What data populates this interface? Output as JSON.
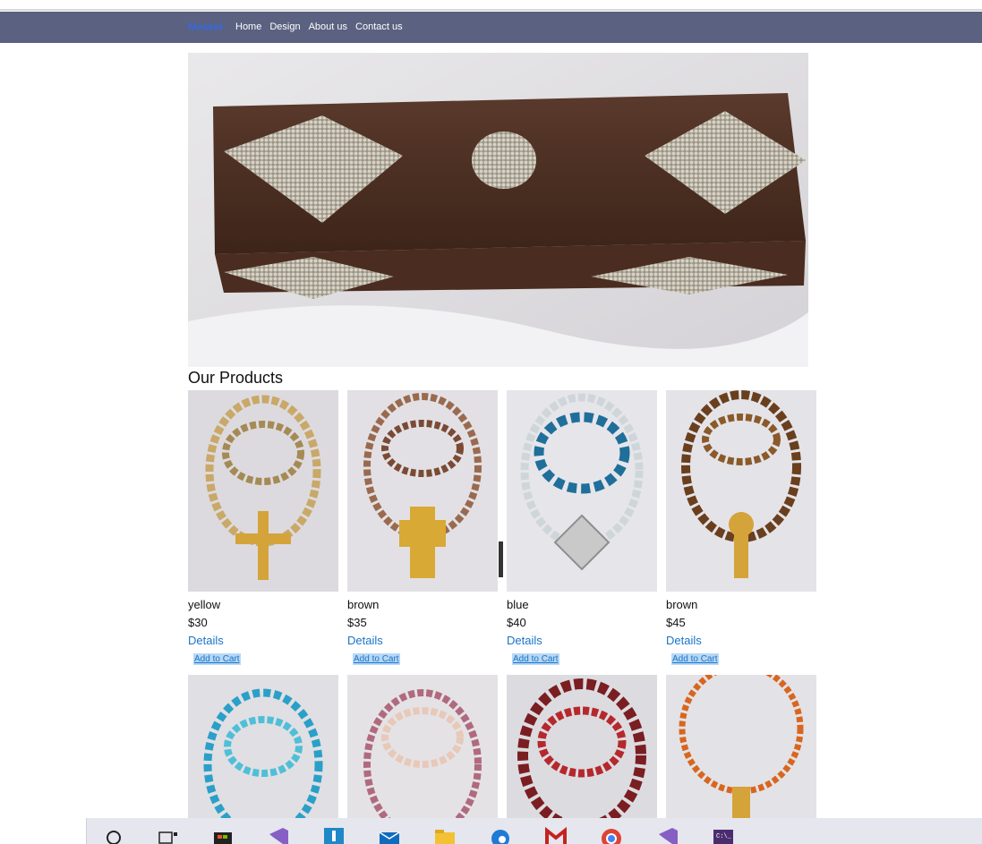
{
  "brand": "Meskel",
  "nav": [
    "Home",
    "Design",
    "About us",
    "Contact us"
  ],
  "section_title": "Our Products",
  "products": [
    {
      "name": "yellow",
      "price": "$30",
      "details": "Details",
      "cart": "Add to Cart"
    },
    {
      "name": "brown",
      "price": "$35",
      "details": "Details",
      "cart": "Add to Cart"
    },
    {
      "name": "blue",
      "price": "$40",
      "details": "Details",
      "cart": "Add to Cart"
    },
    {
      "name": "brown",
      "price": "$45",
      "details": "Details",
      "cart": "Add to Cart"
    }
  ],
  "taskbar_icons": [
    "search-icon",
    "task-view-icon",
    "store-icon",
    "visual-studio-icon",
    "app-l-icon",
    "mail-icon",
    "file-explorer-icon",
    "edge-icon",
    "gmail-icon",
    "chrome-icon",
    "visual-studio-icon",
    "terminal-icon"
  ]
}
